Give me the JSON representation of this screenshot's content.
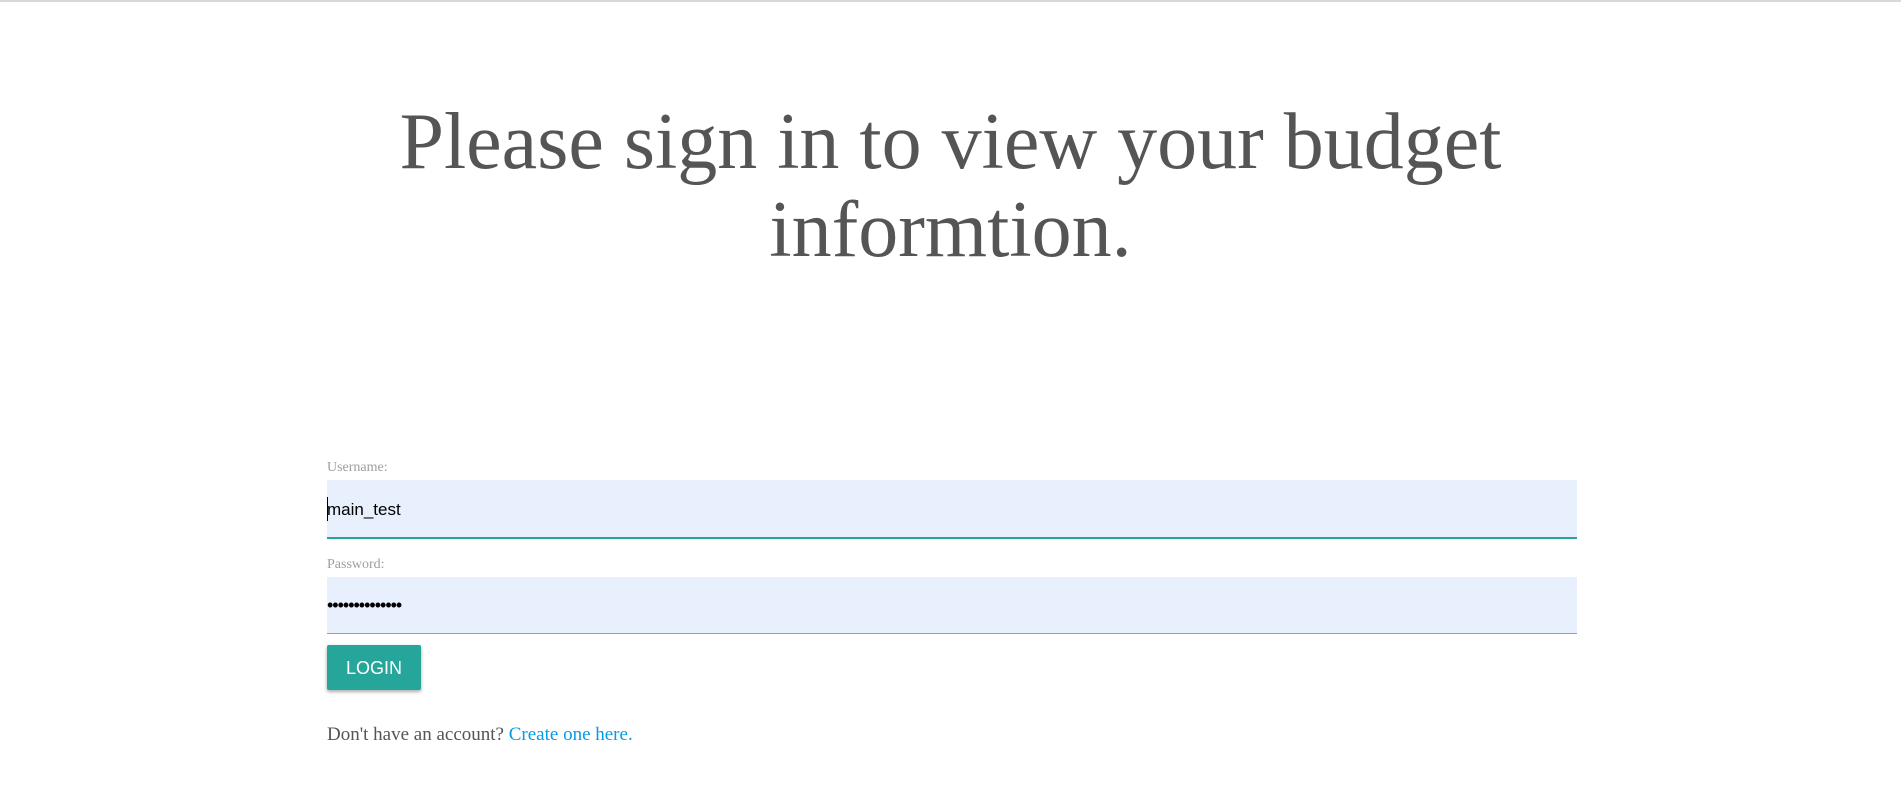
{
  "page": {
    "heading_line1": "Please sign in to view your budget",
    "heading_line2": "informtion."
  },
  "form": {
    "username_label": "Username:",
    "username_value": "main_test",
    "password_label": "Password:",
    "password_value": "••••••••••••••",
    "login_label": "LOGIN"
  },
  "signup": {
    "prompt": "Don't have an account?",
    "link_text": "Create one here."
  },
  "colors": {
    "accent": "#26a69a",
    "link": "#039be5",
    "input_bg": "#e8f0fe",
    "heading_text": "#555555"
  }
}
